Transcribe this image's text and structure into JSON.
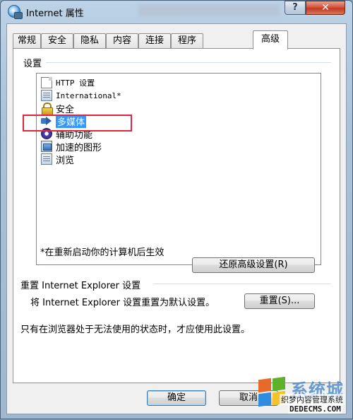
{
  "window": {
    "title": "Internet 属性",
    "help_label": "?",
    "close_label": "✕"
  },
  "tabs": [
    {
      "label": "常规"
    },
    {
      "label": "安全"
    },
    {
      "label": "隐私"
    },
    {
      "label": "内容"
    },
    {
      "label": "连接"
    },
    {
      "label": "程序"
    },
    {
      "label": "高级",
      "active": true
    }
  ],
  "settings": {
    "group_label": "设置",
    "items": [
      {
        "label": "HTTP 设置",
        "icon": "document-icon"
      },
      {
        "label": "International*",
        "icon": "folder-icon"
      },
      {
        "label": "安全",
        "icon": "lock-icon"
      },
      {
        "label": "多媒体",
        "icon": "multimedia-icon",
        "selected": true
      },
      {
        "label": "辅助功能",
        "icon": "accessibility-icon"
      },
      {
        "label": "加速的图形",
        "icon": "accelerated-graphics-icon"
      },
      {
        "label": "浏览",
        "icon": "folder-icon"
      }
    ],
    "restart_note": "*在重新启动你的计算机后生效",
    "restore_button": "还原高级设置(R)"
  },
  "reset": {
    "group_label": "重置 Internet Explorer 设置",
    "description": "将 Internet Explorer 设置重置为默认设置。",
    "reset_button": "重置(S)...",
    "warning": "只有在浏览器处于无法使用的状态时，才应使用此设置。"
  },
  "footer": {
    "ok_button": "确定",
    "cancel_button": "取消"
  },
  "watermark": {
    "logo_text": "系统城",
    "line1": "织梦内容管理系统",
    "line2": "DEDECMS.COM"
  },
  "colors": {
    "selection": "#3399ff",
    "highlight_box": "#e0263d"
  }
}
